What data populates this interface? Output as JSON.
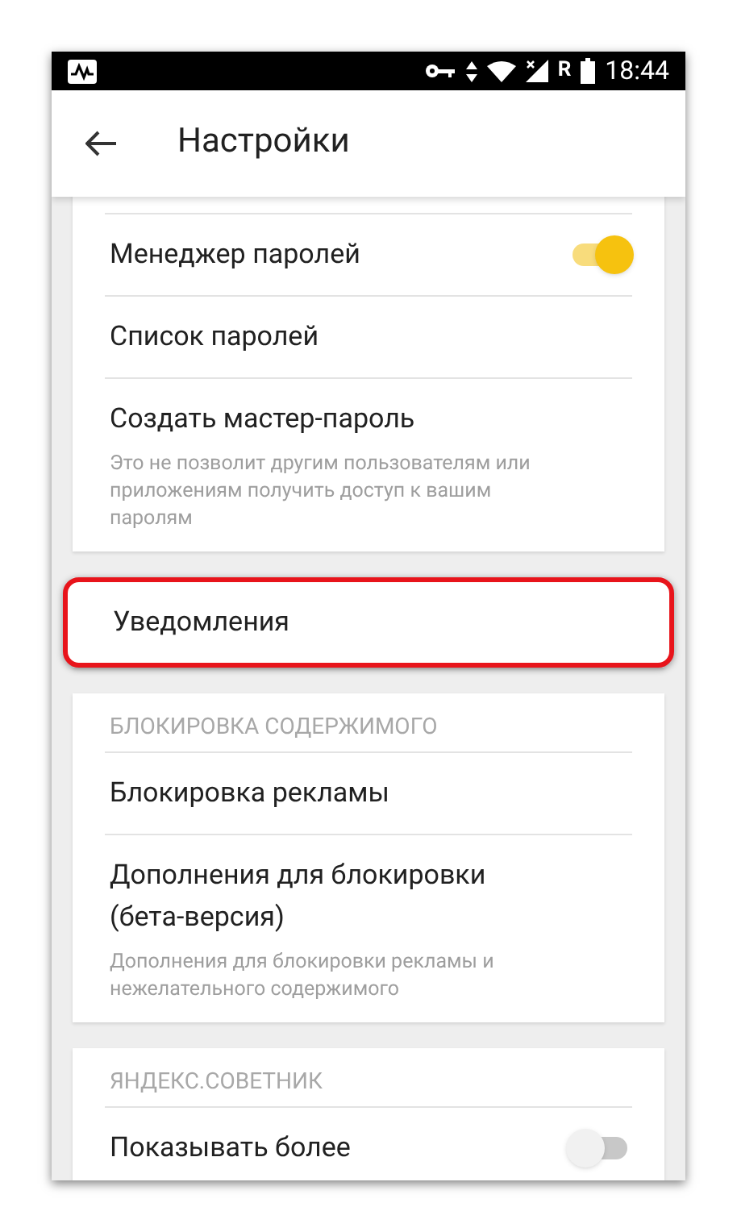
{
  "status_bar": {
    "roaming": "R",
    "time": "18:44"
  },
  "app_bar": {
    "title": "Настройки"
  },
  "sections": [
    {
      "items": [
        {
          "kind": "toggle",
          "label": "Менеджер паролей",
          "on": true
        },
        {
          "kind": "link",
          "label": "Список паролей"
        },
        {
          "kind": "link",
          "label": "Создать мастер-пароль",
          "description": "Это не позволит другим пользователям или приложениям получить доступ к вашим паролям"
        }
      ]
    },
    {
      "items": [
        {
          "kind": "link",
          "label": "Уведомления",
          "highlighted": true
        }
      ]
    },
    {
      "header": "БЛОКИРОВКА СОДЕРЖИМОГО",
      "items": [
        {
          "kind": "link",
          "label": "Блокировка рекламы"
        },
        {
          "kind": "link",
          "label": "Дополнения для блокировки (бета-версия)",
          "description": "Дополнения для блокировки рекламы и нежелательного содержимого"
        }
      ]
    },
    {
      "header": "ЯНДЕКС.СОВЕТНИК",
      "items": [
        {
          "kind": "toggle",
          "label": "Показывать более",
          "on": false
        }
      ]
    }
  ]
}
